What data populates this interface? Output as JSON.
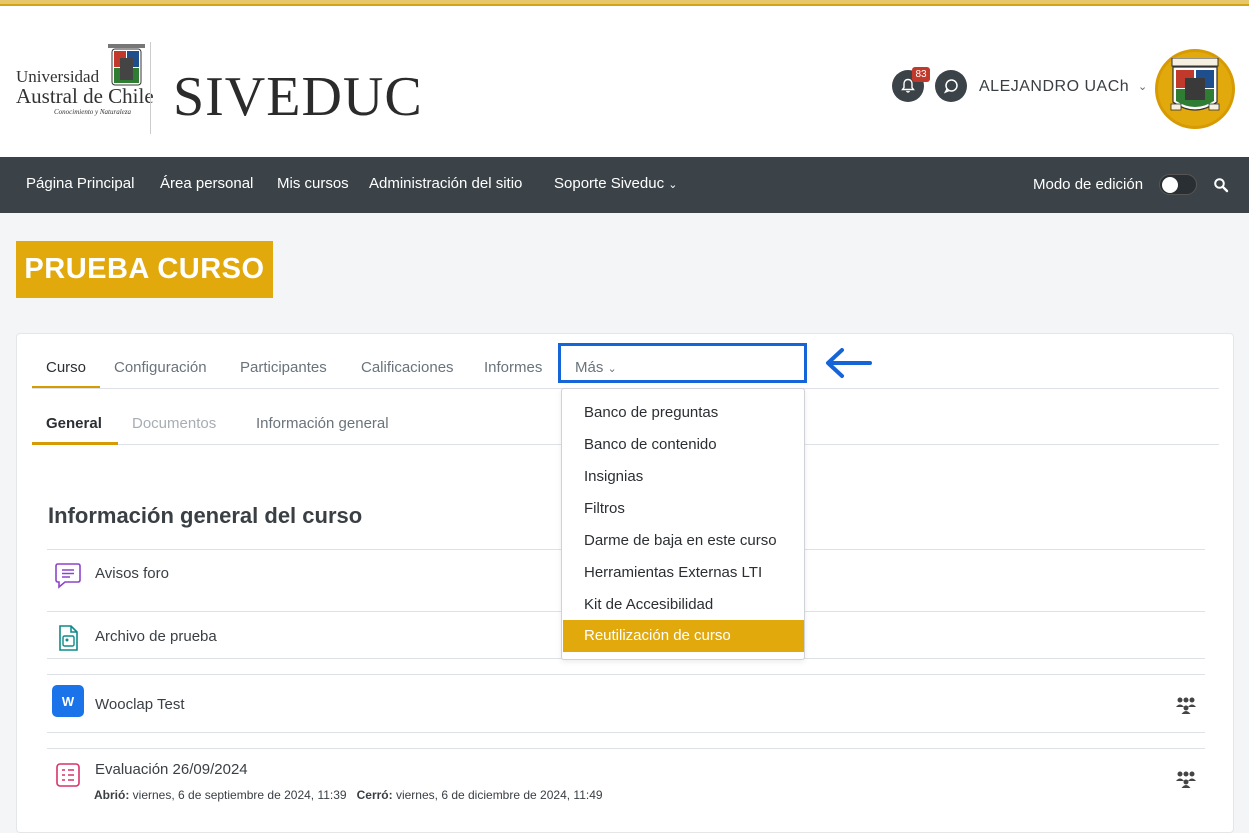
{
  "brand": {
    "university_line1": "Universidad",
    "university_line2": "Austral de Chile",
    "university_tagline": "Conocimiento y Naturaleza",
    "site_name": "SIVEDUC"
  },
  "header": {
    "notification_count": "83",
    "user_name": "ALEJANDRO UACh"
  },
  "primary_nav": {
    "items": [
      "Página Principal",
      "Área personal",
      "Mis cursos",
      "Administración del sitio",
      "Soporte Siveduc"
    ],
    "edit_mode_label": "Modo de edición"
  },
  "course": {
    "title": "PRUEBA CURSO"
  },
  "secondary_nav": {
    "tabs": [
      "Curso",
      "Configuración",
      "Participantes",
      "Calificaciones",
      "Informes",
      "Más"
    ]
  },
  "section_tabs": {
    "tabs": [
      "General",
      "Documentos",
      "Información general"
    ]
  },
  "more_menu": {
    "items": [
      "Banco de preguntas",
      "Banco de contenido",
      "Insignias",
      "Filtros",
      "Darme de baja en este curso",
      "Herramientas Externas LTI",
      "Kit de Accesibilidad",
      "Reutilización de curso"
    ],
    "highlighted_index": 7
  },
  "content": {
    "section_title": "Información general del curso",
    "activities": [
      {
        "name": "Avisos foro",
        "icon": "forum-icon"
      },
      {
        "name": "Archivo de prueba",
        "icon": "file-icon"
      },
      {
        "name": "Wooclap Test",
        "icon": "wooclap-icon"
      },
      {
        "name": "Evaluación 26/09/2024",
        "icon": "quiz-icon",
        "opened_label": "Abrió:",
        "opened_value": "viernes, 6 de septiembre de 2024, 11:39",
        "closed_label": "Cerró:",
        "closed_value": "viernes, 6 de diciembre de 2024, 11:49"
      }
    ]
  },
  "colors": {
    "accent": "#e2a90c",
    "nav_bg": "#3b4348",
    "highlight_box": "#1565d8"
  }
}
